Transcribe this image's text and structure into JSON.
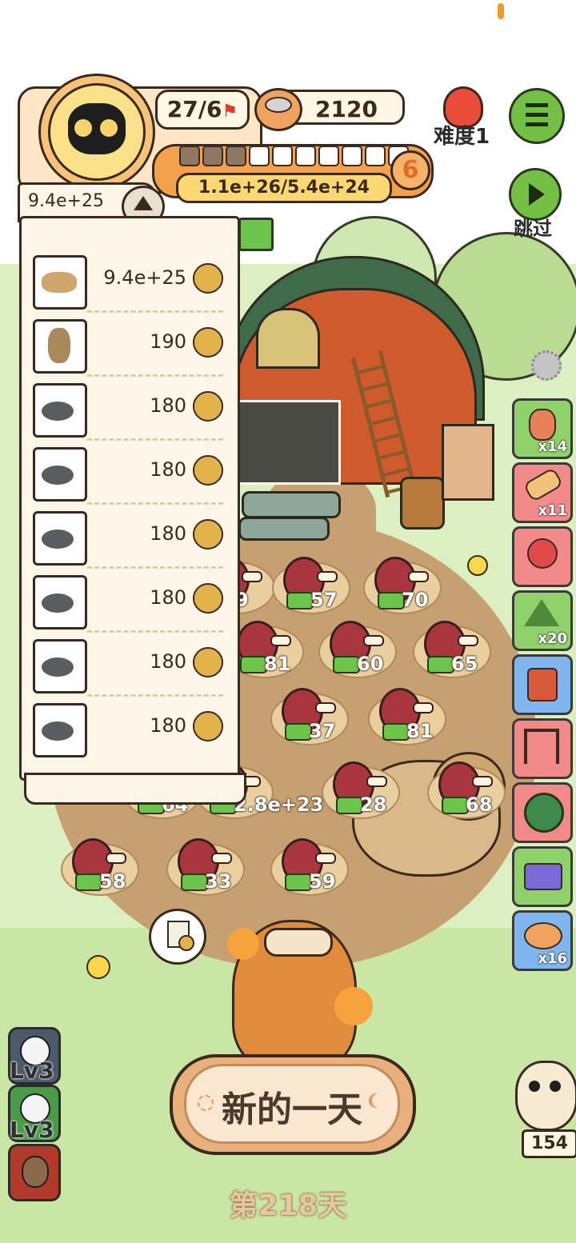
{
  "header": {
    "progress_ratio": "27/6",
    "coins": "2120",
    "level_badge": "6",
    "hp_text": "1.1e+26/5.4e+24",
    "segments_total": 10,
    "segments_filled": 3,
    "difficulty_label": "难度1"
  },
  "skip": {
    "label": "跳过"
  },
  "ranking": {
    "top_value": "9.4e+25",
    "rows": [
      {
        "creature": "sabertooth-beast",
        "value": "9.4e+25"
      },
      {
        "creature": "armored-rodent",
        "value": "190"
      },
      {
        "creature": "mole",
        "value": "180"
      },
      {
        "creature": "mole",
        "value": "180"
      },
      {
        "creature": "mole",
        "value": "180"
      },
      {
        "creature": "mole",
        "value": "180"
      },
      {
        "creature": "mole",
        "value": "180"
      },
      {
        "creature": "mole",
        "value": "180"
      }
    ]
  },
  "meat_slots": [
    {
      "value": "9"
    },
    {
      "value": "57"
    },
    {
      "value": "70"
    },
    {
      "value": "81"
    },
    {
      "value": "60"
    },
    {
      "value": "65"
    },
    {
      "value": "37"
    },
    {
      "value": "81"
    },
    {
      "value": "64"
    },
    {
      "value": "2.8e+23"
    },
    {
      "value": "28"
    },
    {
      "value": "68"
    },
    {
      "value": "58"
    },
    {
      "value": "33"
    },
    {
      "value": "59"
    }
  ],
  "side_items": [
    {
      "name": "worm",
      "count": "x14",
      "color": "#8fd16a"
    },
    {
      "name": "rope-bundle",
      "count": "x11",
      "color": "#f28a8a"
    },
    {
      "name": "heart-trap",
      "count": "",
      "color": "#f28a8a"
    },
    {
      "name": "tent",
      "count": "x20",
      "color": "#8fd16a"
    },
    {
      "name": "grinder",
      "count": "",
      "color": "#7fb6f0"
    },
    {
      "name": "meat-rack",
      "count": "",
      "color": "#f28a8a"
    },
    {
      "name": "spiky-ball",
      "count": "",
      "color": "#f28a8a"
    },
    {
      "name": "card",
      "count": "",
      "color": "#8fd16a"
    },
    {
      "name": "bread",
      "count": "x16",
      "color": "#7fb6f0"
    }
  ],
  "levels": [
    {
      "label": "Lv3"
    },
    {
      "label": "Lv3"
    }
  ],
  "helper": {
    "count": "154"
  },
  "main_button": {
    "label": "新的一天"
  },
  "day_label": "第218天",
  "colors": {
    "accent_orange": "#f4a14e",
    "menu_green": "#74c044",
    "ground": "#c6a070",
    "grass": "#dcefc0"
  }
}
